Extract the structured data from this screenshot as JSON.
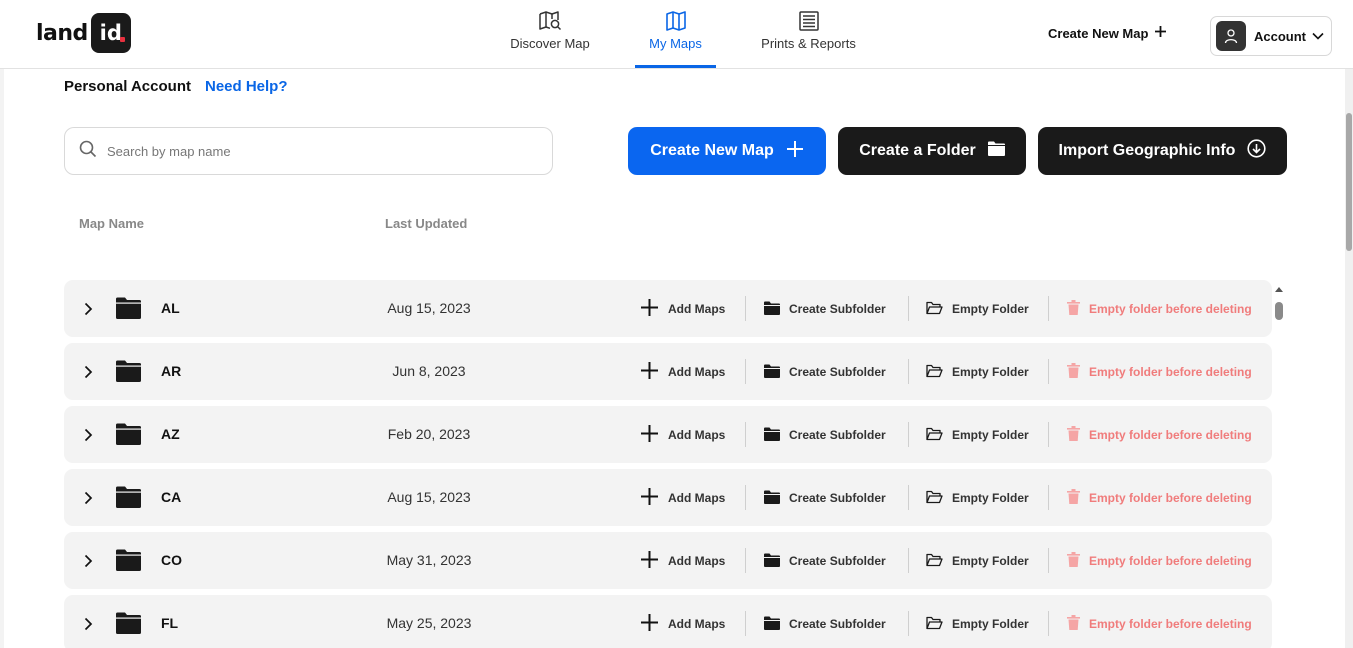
{
  "header": {
    "logo_text": "land",
    "logo_badge": "id",
    "tabs": [
      {
        "label": "Discover Map",
        "icon": "map-search-icon",
        "active": false
      },
      {
        "label": "My Maps",
        "icon": "map-icon",
        "active": true
      },
      {
        "label": "Prints & Reports",
        "icon": "report-icon",
        "active": false
      }
    ],
    "create_map_label": "Create New Map",
    "account_label": "Account"
  },
  "main": {
    "account_title": "Personal Account",
    "help_link": "Need Help?",
    "search_placeholder": "Search by map name",
    "buttons": {
      "create_map": "Create New Map",
      "create_folder": "Create a Folder",
      "import_geo": "Import Geographic Info"
    },
    "columns": {
      "name": "Map Name",
      "updated": "Last Updated"
    },
    "actions": {
      "add": "Add Maps",
      "subfolder": "Create Subfolder",
      "empty": "Empty Folder",
      "delete_disabled": "Empty folder before deleting"
    },
    "rows": [
      {
        "name": "AL",
        "date": "Aug 15, 2023"
      },
      {
        "name": "AR",
        "date": "Jun 8, 2023"
      },
      {
        "name": "AZ",
        "date": "Feb 20, 2023"
      },
      {
        "name": "CA",
        "date": "Aug 15, 2023"
      },
      {
        "name": "CO",
        "date": "May 31, 2023"
      },
      {
        "name": "FL",
        "date": "May 25, 2023"
      }
    ]
  },
  "colors": {
    "accent": "#0a66f0",
    "dark_button": "#1a1a1a",
    "disabled_delete": "#f07c7c",
    "row_bg": "#f3f3f3"
  }
}
